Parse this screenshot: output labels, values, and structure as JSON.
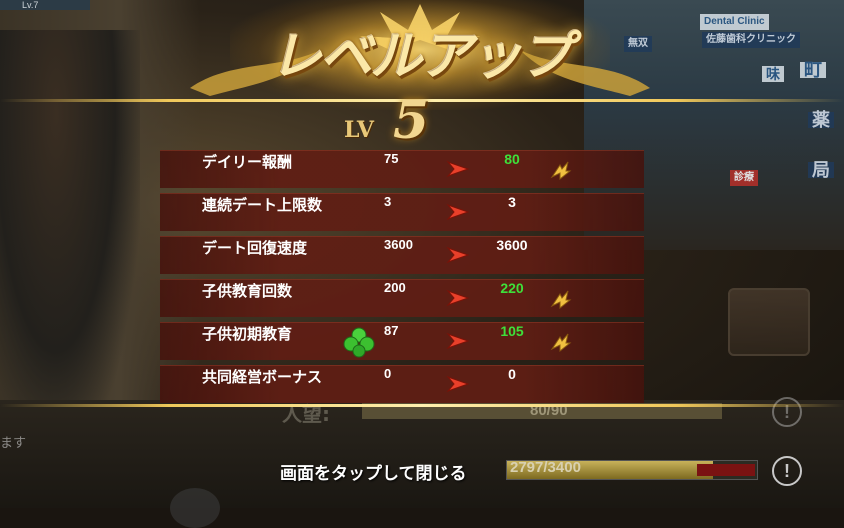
{
  "hud": {
    "level_badge": "Lv.7"
  },
  "background_signs": [
    "Dental Clinic",
    "佐藤歯科クリニック",
    "無双",
    "町",
    "味",
    "薬",
    "局",
    "診療"
  ],
  "banner": {
    "title": "レベルアップ",
    "level_label": "LV",
    "level_value": "5"
  },
  "stats": [
    {
      "label": "デイリー報酬",
      "before": "75",
      "after": "80",
      "increased": true,
      "bonus_icon": false
    },
    {
      "label": "連続デート上限数",
      "before": "3",
      "after": "3",
      "increased": false,
      "bonus_icon": false
    },
    {
      "label": "デート回復速度",
      "before": "3600",
      "after": "3600",
      "increased": false,
      "bonus_icon": false
    },
    {
      "label": "子供教育回数",
      "before": "200",
      "after": "220",
      "increased": true,
      "bonus_icon": false
    },
    {
      "label": "子供初期教育",
      "before": "87",
      "after": "105",
      "increased": true,
      "bonus_icon": true
    },
    {
      "label": "共同経営ボーナス",
      "before": "0",
      "after": "0",
      "increased": false,
      "bonus_icon": false
    }
  ],
  "status": {
    "popularity_label": "人望:",
    "popularity_value": "80/90",
    "tap_to_close": "画面をタップして閉じる",
    "exp_value": "2797/3400",
    "exp_fraction": 0.823,
    "left_chat_fragment": "ます"
  },
  "colors": {
    "increase": "#3ee03a",
    "gold": "#f0c85a",
    "row_bg": "#5f1e14"
  }
}
